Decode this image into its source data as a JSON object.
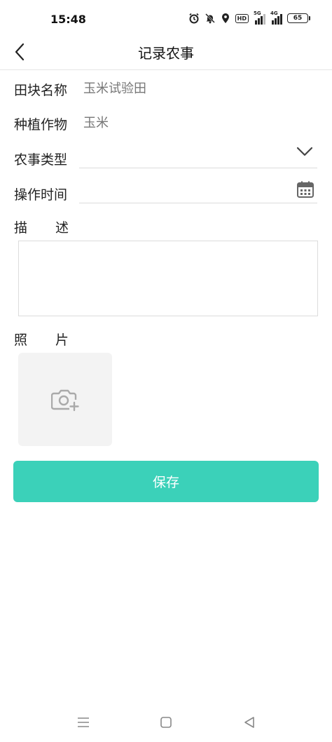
{
  "status": {
    "time": "15:48",
    "hd": "HD",
    "net1": "5G",
    "net2": "4G",
    "battery": "65"
  },
  "header": {
    "title": "记录农事"
  },
  "form": {
    "field_name_label": "田块名称",
    "field_name_value": "玉米试验田",
    "crop_label": "种植作物",
    "crop_value": "玉米",
    "type_label": "农事类型",
    "time_label": "操作时间",
    "desc_label_1": "描",
    "desc_label_2": "述",
    "photo_label_1": "照",
    "photo_label_2": "片"
  },
  "actions": {
    "save_label": "保存"
  },
  "colors": {
    "accent": "#3bd1b9"
  },
  "icons": [
    "back-arrow-icon",
    "chevron-down-icon",
    "calendar-icon",
    "camera-add-icon",
    "alarm-icon",
    "mute-bell-icon",
    "location-icon"
  ]
}
